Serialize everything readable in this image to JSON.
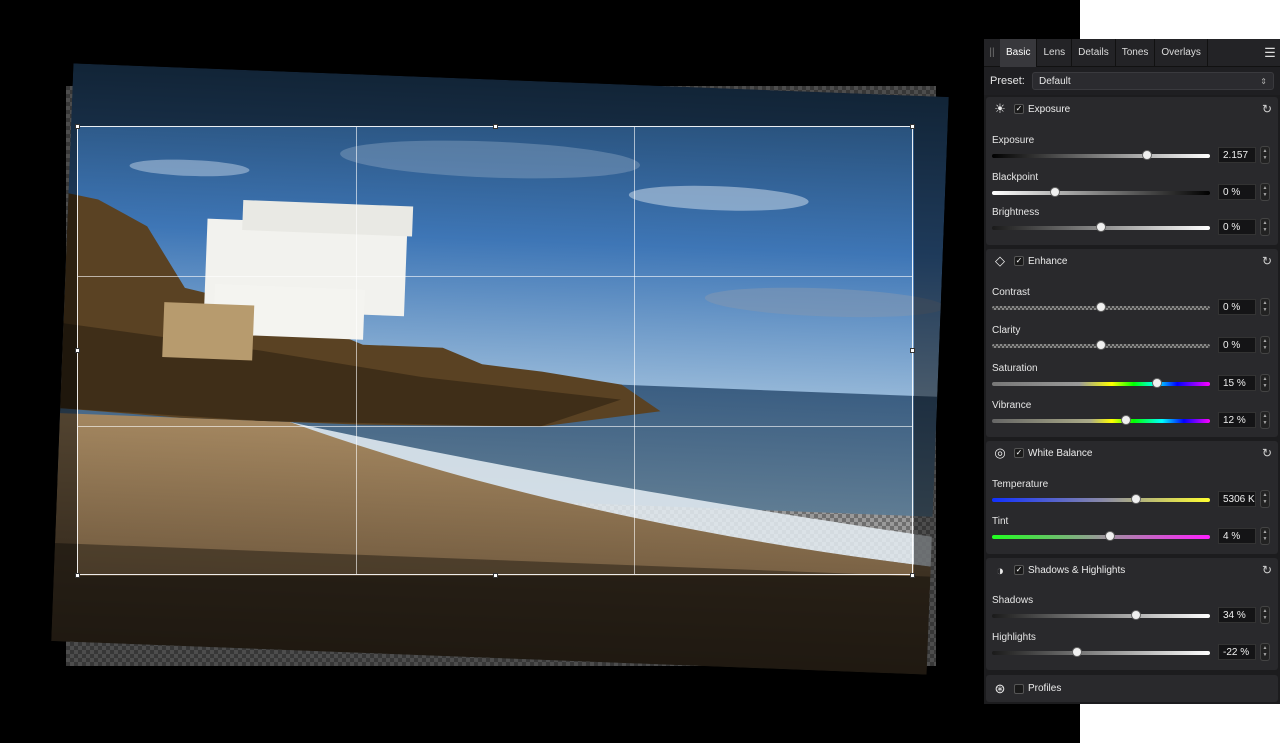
{
  "panel": {
    "tabs": [
      "Basic",
      "Lens",
      "Details",
      "Tones",
      "Overlays"
    ],
    "active_tab": "Basic",
    "preset": {
      "label": "Preset:",
      "value": "Default"
    },
    "sections": {
      "exposure": {
        "title": "Exposure",
        "checked": true,
        "rows": [
          {
            "label": "Exposure",
            "value": "2.157",
            "level": 0.71
          },
          {
            "label": "Blackpoint",
            "value": "0 %",
            "level": 0.29
          },
          {
            "label": "Brightness",
            "value": "0 %",
            "level": 0.5
          }
        ]
      },
      "enhance": {
        "title": "Enhance",
        "checked": true,
        "rows": [
          {
            "label": "Contrast",
            "value": "0 %",
            "level": 0.5
          },
          {
            "label": "Clarity",
            "value": "0 %",
            "level": 0.5
          },
          {
            "label": "Saturation",
            "value": "15 %",
            "level": 0.755
          },
          {
            "label": "Vibrance",
            "value": "12 %",
            "level": 0.615
          }
        ]
      },
      "white_balance": {
        "title": "White Balance",
        "checked": true,
        "rows": [
          {
            "label": "Temperature",
            "value": "5306 K",
            "level": 0.66
          },
          {
            "label": "Tint",
            "value": "4 %",
            "level": 0.54
          }
        ]
      },
      "shadows_highlights": {
        "title": "Shadows & Highlights",
        "checked": true,
        "rows": [
          {
            "label": "Shadows",
            "value": "34 %",
            "level": 0.66
          },
          {
            "label": "Highlights",
            "value": "-22 %",
            "level": 0.39
          }
        ]
      },
      "profiles": {
        "title": "Profiles",
        "checked": false
      }
    }
  },
  "colors": {
    "panel_bg": "#1c1c1e",
    "section_bg": "#29292c",
    "canvas_bg": "#000000"
  },
  "icons": {
    "exposure": "sun-icon",
    "enhance": "diamond-icon",
    "white_balance": "white-balance-icon",
    "shadows_highlights": "half-circle-icon",
    "profiles": "profiles-icon",
    "reset": "reset-icon",
    "menu": "hamburger-icon"
  }
}
